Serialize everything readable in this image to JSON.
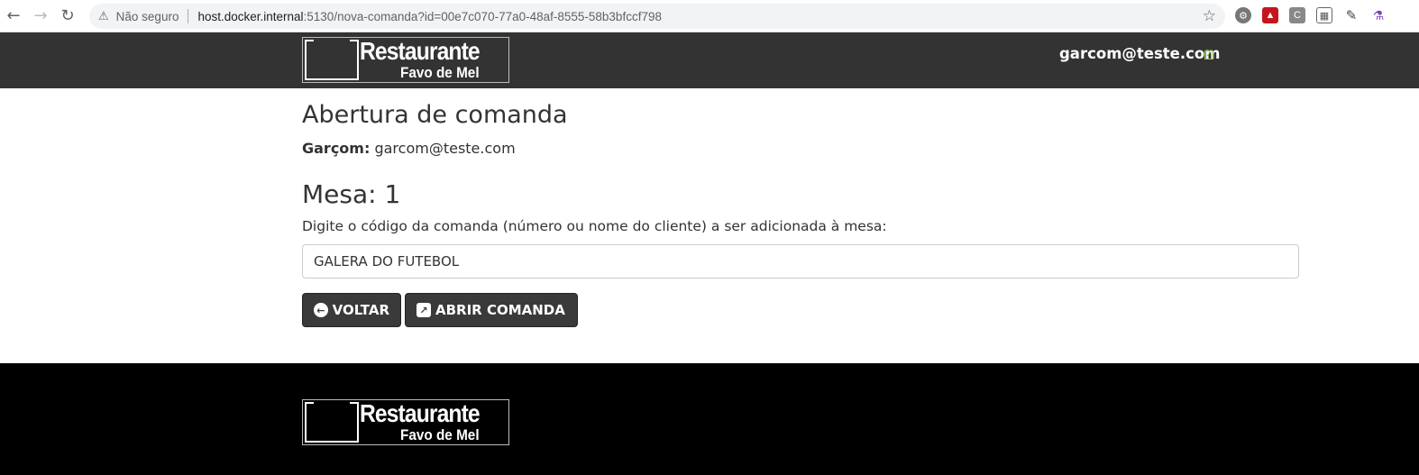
{
  "browser": {
    "security_label": "Não seguro",
    "url_host": "host.docker.internal",
    "url_rest": ":5130/nova-comanda?id=00e7c070-77a0-48af-8555-58b3bfccf798",
    "nav_icons": [
      "back-arrow-icon",
      "forward-arrow-icon",
      "reload-icon"
    ],
    "extension_icons": [
      "settings-extension-icon",
      "pdf-extension-icon",
      "c-extension-icon",
      "grid-extension-icon",
      "pencil-extension-icon",
      "flask-extension-icon"
    ]
  },
  "header": {
    "logo_name": "Restaurante",
    "logo_sub": "Favo de Mel",
    "user_email": "garcom@teste.com"
  },
  "main": {
    "title": "Abertura de comanda",
    "waiter_label": "Garçom:",
    "waiter_value": "garcom@teste.com",
    "table_title": "Mesa: 1",
    "instructions": "Digite o código da comanda (número ou nome do cliente) a ser adicionada à mesa:",
    "code_value": "GALERA DO FUTEBOL",
    "back_label": "VOLTAR",
    "open_label": "ABRIR COMANDA"
  },
  "footer": {
    "logo_name": "Restaurante",
    "logo_sub": "Favo de Mel"
  },
  "colors": {
    "header_bg": "#333333",
    "footer_bg": "#000000",
    "button_bg": "#3a3a3a",
    "check": "#8bc34a"
  }
}
